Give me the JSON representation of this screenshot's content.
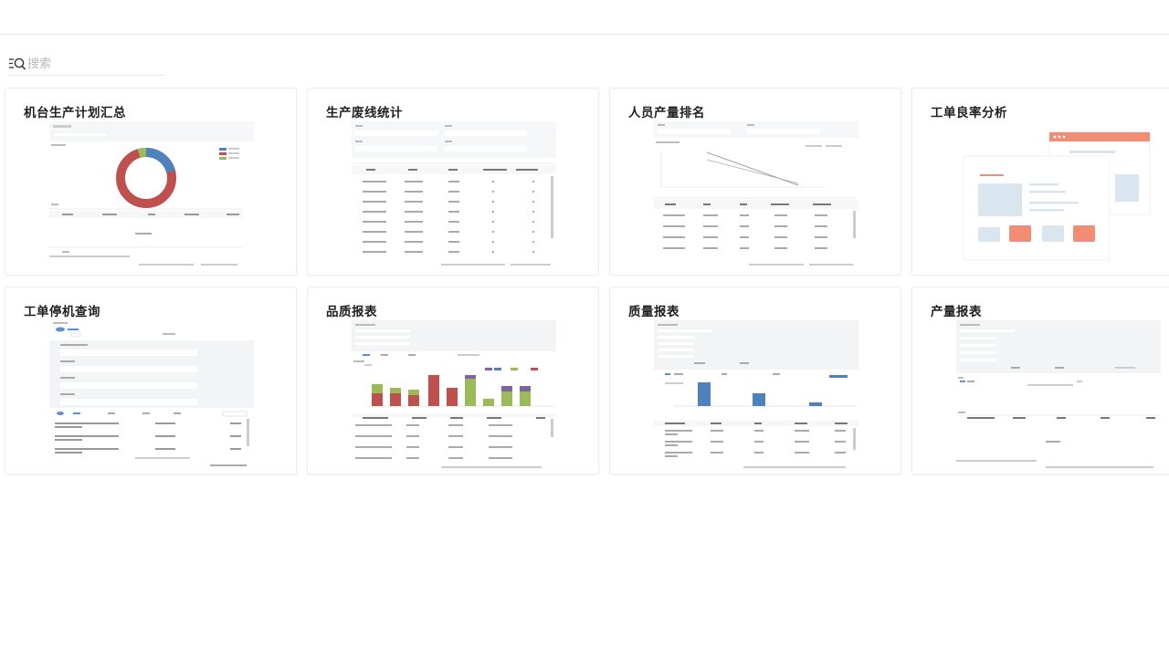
{
  "search": {
    "placeholder": "搜索"
  },
  "cards": [
    {
      "title": "机台生产计划汇总",
      "thumb": "donut-report"
    },
    {
      "title": "生产废线统计",
      "thumb": "table-report"
    },
    {
      "title": "人员产量排名",
      "thumb": "line-table-report"
    },
    {
      "title": "工单良率分析",
      "thumb": "illustration"
    },
    {
      "title": "工单停机查询",
      "thumb": "form-table-report"
    },
    {
      "title": "品质报表",
      "thumb": "stacked-bar-report"
    },
    {
      "title": "质量报表",
      "thumb": "bar-table-report"
    },
    {
      "title": "产量报表",
      "thumb": "empty-table-report"
    }
  ],
  "colors": {
    "accent": "#5b8fd6",
    "donut_red": "#c0504d",
    "donut_blue": "#4f81bd",
    "donut_green": "#9bbb59",
    "illus_orange": "#f48c74",
    "illus_blue": "#d9e5ef"
  }
}
